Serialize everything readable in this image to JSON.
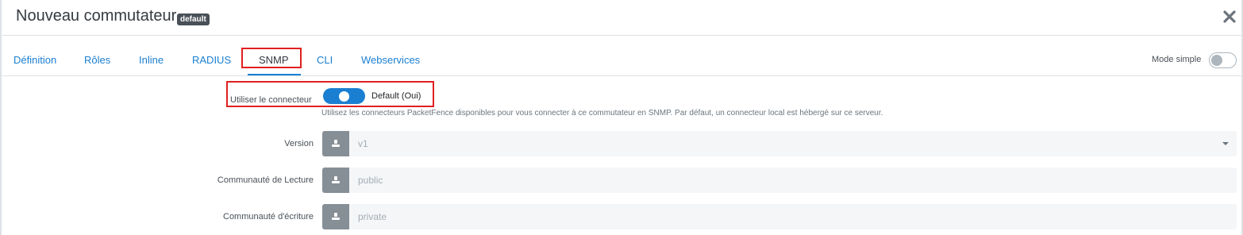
{
  "header": {
    "title": "Nouveau commutateur",
    "badge": "default",
    "close_icon": "close-icon"
  },
  "tabs": [
    {
      "label": "Définition"
    },
    {
      "label": "Rôles"
    },
    {
      "label": "Inline"
    },
    {
      "label": "RADIUS"
    },
    {
      "label": "SNMP",
      "active": true
    },
    {
      "label": "CLI"
    },
    {
      "label": "Webservices"
    }
  ],
  "mode_simple": {
    "label": "Mode simple",
    "enabled": false
  },
  "connector": {
    "label": "Utiliser le connecteur",
    "status": "Default (Oui)",
    "enabled": true,
    "help": "Utilisez les connecteurs PacketFence disponibles pour vous connecter à ce commutateur en SNMP. Par défaut, un connecteur local est hébergé sur ce serveur."
  },
  "fields": {
    "version": {
      "label": "Version",
      "value": "v1",
      "icon": "inherit-icon"
    },
    "read_community": {
      "label": "Communauté de Lecture",
      "value": "public",
      "icon": "inherit-icon"
    },
    "write_community": {
      "label": "Communauté d'écriture",
      "value": "private",
      "icon": "inherit-icon"
    }
  },
  "colors": {
    "accent": "#1a7fd1",
    "highlight": "#e02020",
    "badge": "#495057"
  }
}
